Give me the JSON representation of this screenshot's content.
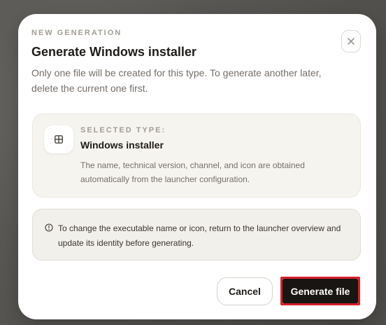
{
  "dialog": {
    "eyebrow": "NEW GENERATION",
    "title": "Generate Windows installer",
    "description": "Only one file will be created for this type. To generate another later, delete the current one first.",
    "close_icon": "close-icon"
  },
  "selected_type": {
    "label": "SELECTED TYPE:",
    "title": "Windows installer",
    "description": "The name, technical version, channel, and icon are obtained automatically from the launcher configuration.",
    "icon": "windows-grid-icon"
  },
  "notice": {
    "icon": "info-circle-icon",
    "text": "To change the executable name or icon, return to the launcher overview and update its identity before generating."
  },
  "actions": {
    "cancel_label": "Cancel",
    "generate_label": "Generate file"
  },
  "colors": {
    "primary_button": "#181512",
    "highlight_outline": "#d81f2a"
  }
}
